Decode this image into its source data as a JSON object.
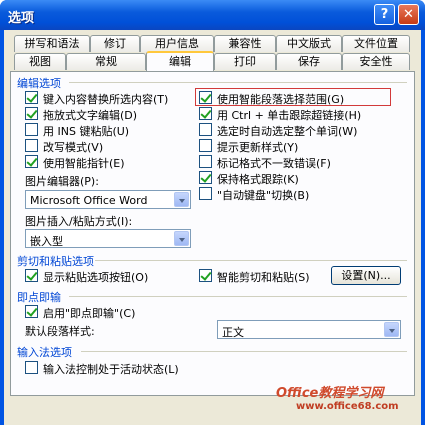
{
  "window": {
    "title": "选项",
    "help_glyph": "?",
    "close_glyph": "✕"
  },
  "tabs_row1": [
    "拼写和语法",
    "修订",
    "用户信息",
    "兼容性",
    "中文版式",
    "文件位置"
  ],
  "tabs_row2": [
    "视图",
    "常规",
    "编辑",
    "打印",
    "保存",
    "安全性"
  ],
  "active_tab": "编辑",
  "edit_section": {
    "title": "编辑选项",
    "left_options": [
      {
        "label": "键入内容替换所选内容(T)",
        "checked": true
      },
      {
        "label": "拖放式文字编辑(D)",
        "checked": true
      },
      {
        "label": "用 INS 键粘贴(U)",
        "checked": false
      },
      {
        "label": "改写模式(V)",
        "checked": false
      },
      {
        "label": "使用智能指针(E)",
        "checked": true
      }
    ],
    "right_options": [
      {
        "label": "使用智能段落选择范围(G)",
        "checked": true
      },
      {
        "label": "用 Ctrl + 单击跟踪超链接(H)",
        "checked": true
      },
      {
        "label": "选定时自动选定整个单词(W)",
        "checked": false
      },
      {
        "label": "提示更新样式(Y)",
        "checked": false
      },
      {
        "label": "标记格式不一致错误(F)",
        "checked": false
      },
      {
        "label": "保持格式跟踪(K)",
        "checked": true
      },
      {
        "label": "\"自动键盘\"切换(B)",
        "checked": false
      }
    ],
    "picture_editor_label": "图片编辑器(P):",
    "picture_editor_value": "Microsoft Office Word",
    "insert_paste_label": "图片插入/粘贴方式(I):",
    "insert_paste_value": "嵌入型"
  },
  "cut_paste_section": {
    "title": "剪切和粘贴选项",
    "show_paste_buttons": {
      "label": "显示粘贴选项按钮(O)",
      "checked": true
    },
    "smart_cut_paste": {
      "label": "智能剪切和粘贴(S)",
      "checked": true
    },
    "settings_button": "设置(N)..."
  },
  "click_type_section": {
    "title": "即点即输",
    "enable": {
      "label": "启用\"即点即输\"(C)",
      "checked": true
    },
    "default_style_label": "默认段落样式:",
    "default_style_value": "正文"
  },
  "ime_section": {
    "title": "输入法选项",
    "ime_control": {
      "label": "输入法控制处于活动状态(L)",
      "checked": false
    }
  },
  "watermark": {
    "text": "Office教程学习网",
    "url": "www.office68.com"
  }
}
